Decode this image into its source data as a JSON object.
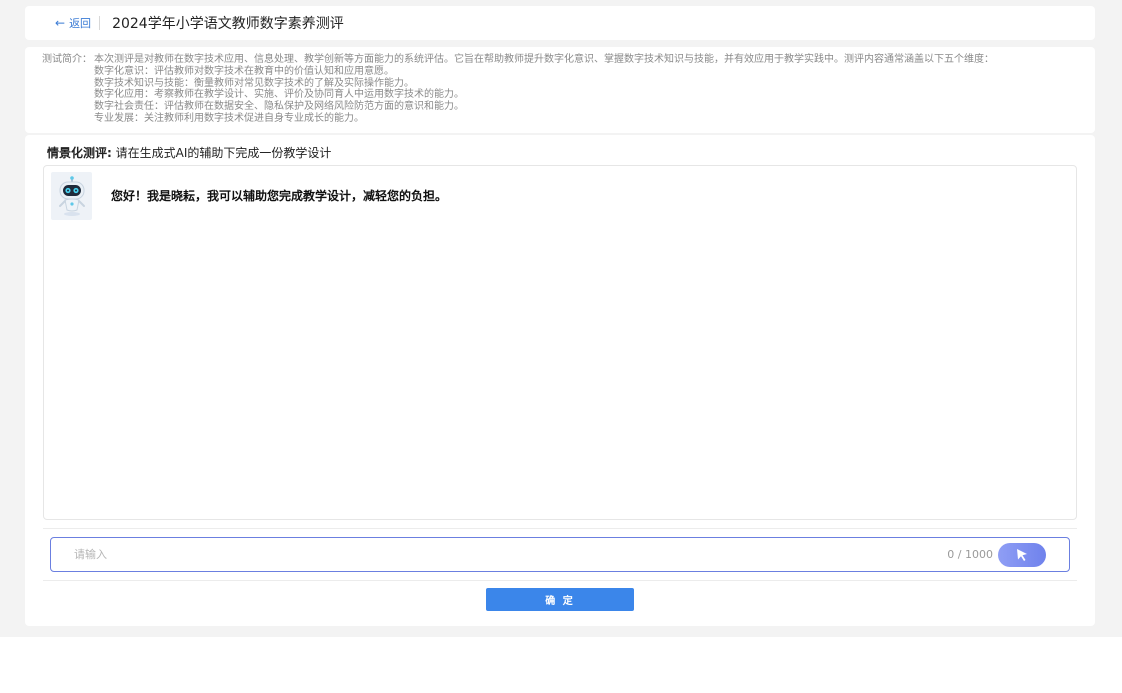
{
  "header": {
    "back_label": "返回",
    "title": "2024学年小学语文教师数字素养测评"
  },
  "intro": {
    "label": "测试简介：",
    "summary": "本次测评是对教师在数字技术应用、信息处理、教学创新等方面能力的系统评估。它旨在帮助教师提升数字化意识、掌握数字技术知识与技能，并有效应用于教学实践中。测评内容通常涵盖以下五个维度：",
    "dimensions": [
      "数字化意识：评估教师对数字技术在教育中的价值认知和应用意愿。",
      "数字技术知识与技能：衡量教师对常见数字技术的了解及实际操作能力。",
      "数字化应用：考察教师在教学设计、实施、评价及协同育人中运用数字技术的能力。",
      "数字社会责任：评估教师在数据安全、隐私保护及网络风险防范方面的意识和能力。",
      "专业发展：关注教师利用数字技术促进自身专业成长的能力。"
    ]
  },
  "scenario": {
    "label": "情景化测评:",
    "task": " 请在生成式AI的辅助下完成一份教学设计"
  },
  "chat": {
    "bot_message": "您好！我是晓耘，我可以辅助您完成教学设计，减轻您的负担。"
  },
  "input": {
    "placeholder": "请输入",
    "value": "",
    "char_count": "0 / 1000"
  },
  "actions": {
    "confirm_label": "确 定"
  },
  "icons": {
    "back": "arrow-left-icon",
    "send": "cursor-send-icon",
    "avatar": "robot-avatar"
  },
  "colors": {
    "accent": "#3b86ea",
    "link": "#3a7bd5",
    "input_border": "#6b7fe0"
  }
}
